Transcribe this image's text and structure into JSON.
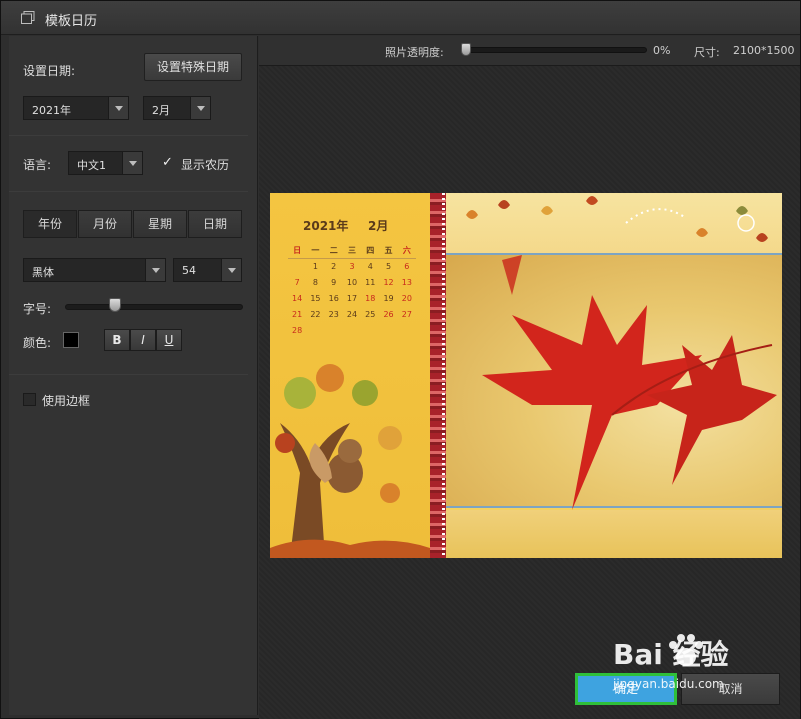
{
  "window": {
    "title": "模板日历"
  },
  "left_panel": {
    "set_date_label": "设置日期:",
    "special_date_button": "设置特殊日期",
    "year_select": "2021年",
    "month_select": "2月",
    "language_label": "语言:",
    "language_select": "中文1",
    "show_lunar_label": "显示农历",
    "show_lunar_checked": true,
    "tabs": [
      "年份",
      "月份",
      "星期",
      "日期"
    ],
    "active_tab": "年份",
    "font_select": "黑体",
    "size_select": "54",
    "font_size_label": "字号:",
    "font_size_level": 0.3,
    "color_label": "颜色:",
    "color_value": "#000000",
    "format_buttons": [
      "B",
      "I",
      "U"
    ],
    "use_border_label": "使用边框",
    "use_border_checked": false
  },
  "top_bar": {
    "opacity_label": "照片透明度:",
    "opacity_value": "0%",
    "size_label": "尺寸:",
    "size_value": "2100*1500"
  },
  "calendar_preview": {
    "year": "2021年",
    "month": "2月",
    "weekdays": [
      "日",
      "一",
      "二",
      "三",
      "四",
      "五",
      "六"
    ],
    "weeks": [
      [
        "",
        "1",
        "2",
        "3",
        "4",
        "5",
        "6"
      ],
      [
        "7",
        "8",
        "9",
        "10",
        "11",
        "12",
        "13"
      ],
      [
        "14",
        "15",
        "16",
        "17",
        "18",
        "19",
        "20"
      ],
      [
        "21",
        "22",
        "23",
        "24",
        "25",
        "26",
        "27"
      ],
      [
        "28",
        "",
        "",
        "",
        "",
        "",
        ""
      ]
    ]
  },
  "buttons": {
    "ok": "确定",
    "cancel": "取消"
  },
  "watermark": {
    "text": "Bai 经验",
    "url": "jingyan.baidu.com"
  }
}
